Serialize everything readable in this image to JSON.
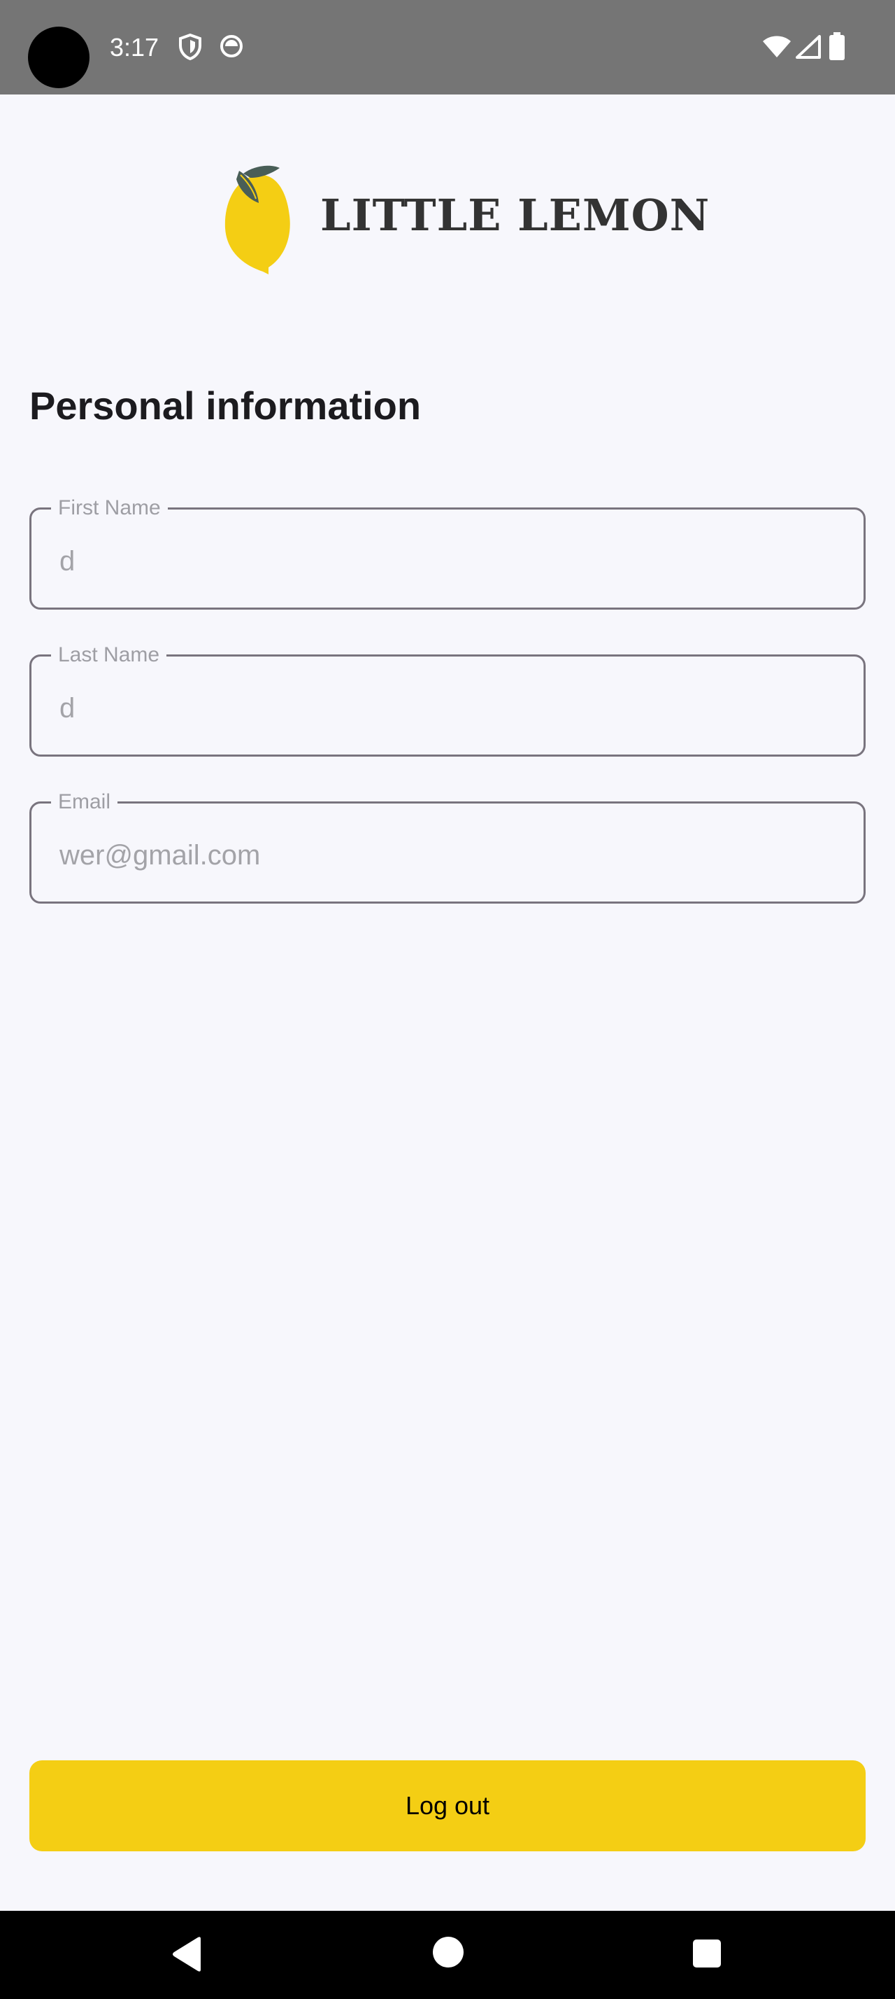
{
  "status_bar": {
    "time": "3:17",
    "icons": [
      "shield-icon",
      "android-notification-icon",
      "wifi-icon",
      "signal-icon",
      "battery-icon"
    ]
  },
  "header": {
    "brand": "LITTLE LEMON",
    "logo_icon": "lemon-icon"
  },
  "profile": {
    "title": "Personal information",
    "fields": [
      {
        "label": "First Name",
        "value": "d"
      },
      {
        "label": "Last Name",
        "value": "d"
      },
      {
        "label": "Email",
        "value": "wer@gmail.com"
      }
    ]
  },
  "actions": {
    "logout_label": "Log out"
  },
  "colors": {
    "accent": "#F4CE14",
    "background": "#F7F7FC",
    "status_bar": "#757575",
    "field_border": "#79747E",
    "brand_text": "#333333"
  },
  "nav_bar": {
    "icons": [
      "back-icon",
      "home-icon",
      "recents-icon"
    ]
  }
}
